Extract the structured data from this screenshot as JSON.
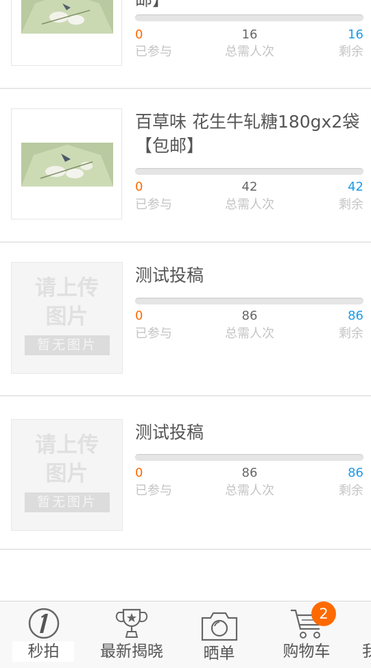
{
  "items": [
    {
      "title": "邮】",
      "participated": "0",
      "total": "16",
      "remaining": "16",
      "image": "painting"
    },
    {
      "title": "百草味 花生牛轧糖180gx2袋【包邮】",
      "participated": "0",
      "total": "42",
      "remaining": "42",
      "image": "painting"
    },
    {
      "title": "测试投稿",
      "participated": "0",
      "total": "86",
      "remaining": "86",
      "image": "placeholder"
    },
    {
      "title": "测试投稿",
      "participated": "0",
      "total": "86",
      "remaining": "86",
      "image": "placeholder"
    }
  ],
  "labels": {
    "participated": "已参与",
    "total": "总需人次",
    "remaining": "剩余"
  },
  "placeholder": {
    "line1": "请上传",
    "line2": "图片",
    "bar": "暂无图片"
  },
  "tabs": [
    {
      "label": "秒拍",
      "icon": "one-circle-icon"
    },
    {
      "label": "最新揭晓",
      "icon": "trophy-icon"
    },
    {
      "label": "晒单",
      "icon": "camera-icon"
    },
    {
      "label": "购物车",
      "icon": "cart-icon"
    },
    {
      "label": "我",
      "icon": "user-icon"
    }
  ],
  "cart_badge": "2",
  "colors": {
    "accent_orange": "#ff6a00",
    "accent_blue": "#1a9be8"
  }
}
